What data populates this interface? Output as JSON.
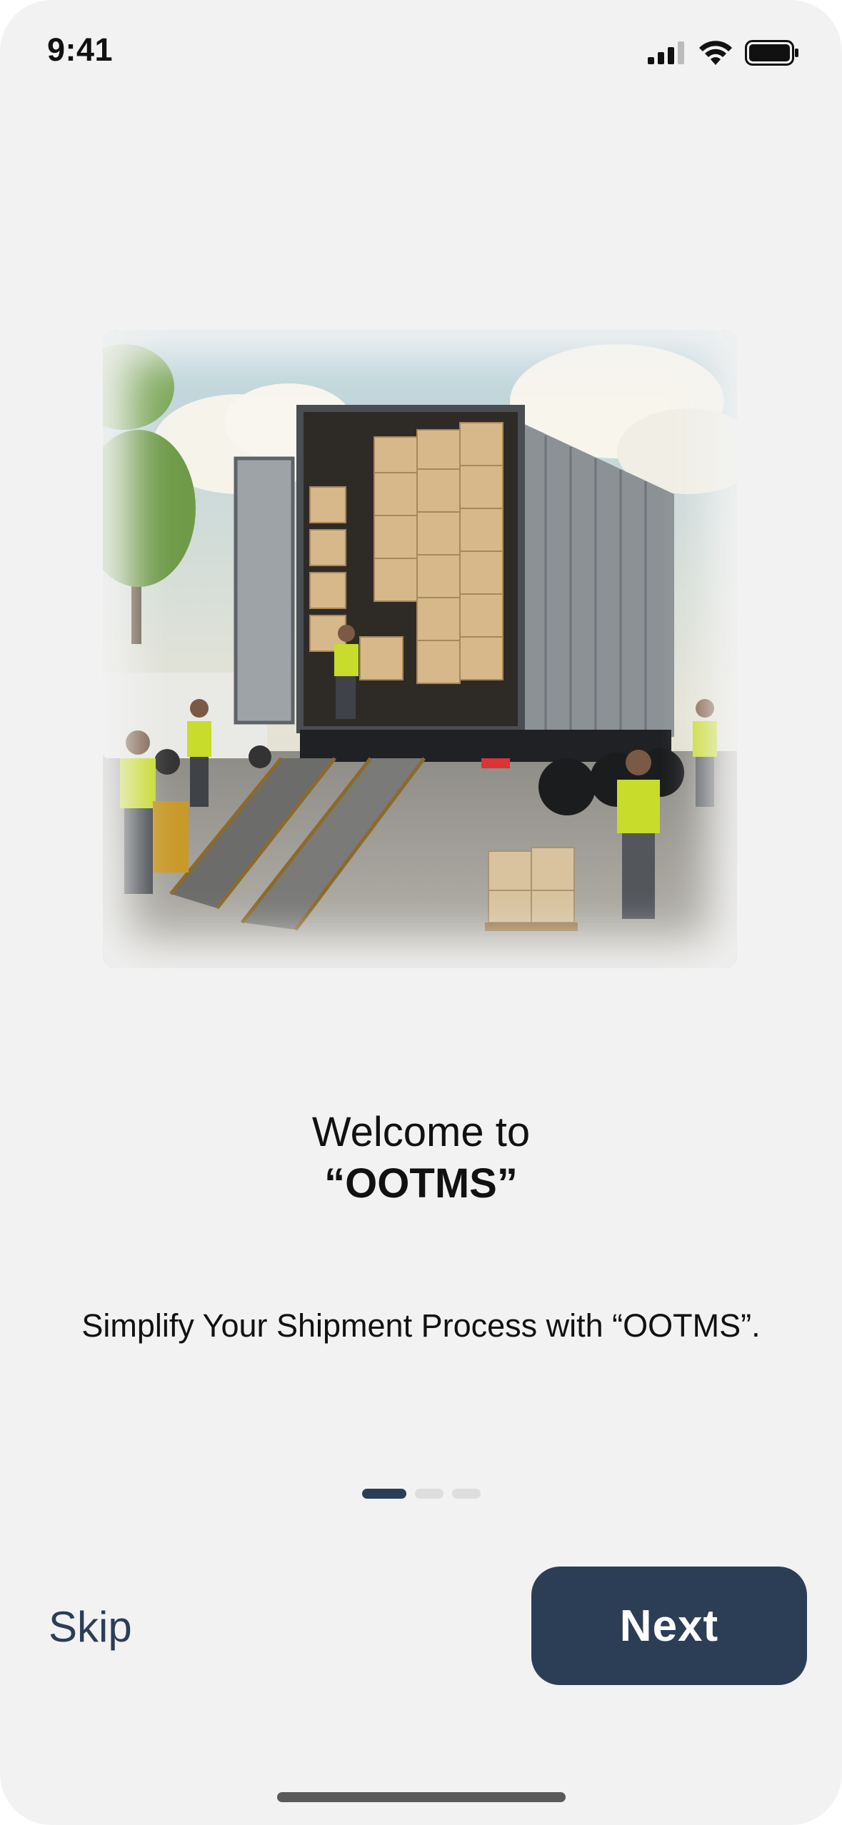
{
  "status_bar": {
    "time": "9:41",
    "signal_icon": "cellular-signal-icon",
    "wifi_icon": "wifi-icon",
    "battery_icon": "battery-icon"
  },
  "hero": {
    "image_icon": "truck-loading-illustration"
  },
  "onboarding": {
    "title_line1": "Welcome to",
    "title_line2": "“OOTMS”",
    "subtitle": "Simplify Your Shipment Process with “OOTMS”.",
    "current_page": 1,
    "total_pages": 3
  },
  "actions": {
    "skip_label": "Skip",
    "next_label": "Next"
  },
  "colors": {
    "primary": "#2c3e55",
    "background": "#f2f2f2",
    "dot_inactive": "#dedede"
  }
}
